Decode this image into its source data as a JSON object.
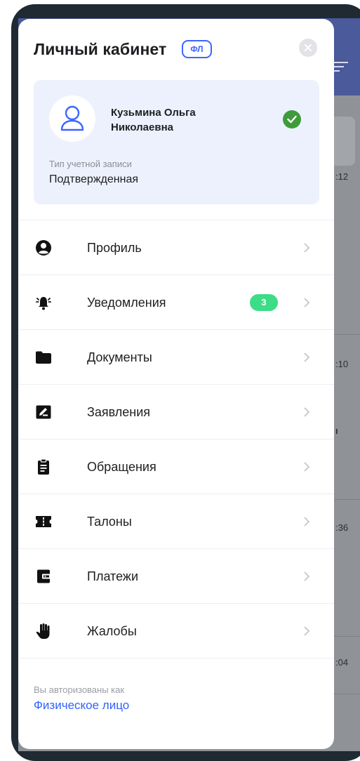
{
  "drawer": {
    "title": "Личный кабинет",
    "badge": "ФЛ",
    "close_icon": "close-icon"
  },
  "user": {
    "name": "Кузьмина Ольга Николаевна",
    "account_type_label": "Тип учетной записи",
    "account_type_value": "Подтвержденная",
    "avatar_icon": "user-outline-icon",
    "verified_icon": "check-circle-icon"
  },
  "menu": {
    "items": [
      {
        "label": "Профиль",
        "icon": "account-circle-icon"
      },
      {
        "label": "Уведомления",
        "icon": "bell-ringing-icon",
        "badge": "3"
      },
      {
        "label": "Документы",
        "icon": "folder-icon"
      },
      {
        "label": "Заявления",
        "icon": "edit-note-icon"
      },
      {
        "label": "Обращения",
        "icon": "clipboard-text-icon"
      },
      {
        "label": "Талоны",
        "icon": "ticket-icon"
      },
      {
        "label": "Платежи",
        "icon": "wallet-icon"
      },
      {
        "label": "Жалобы",
        "icon": "hand-icon"
      }
    ]
  },
  "footer": {
    "label": "Вы авторизованы как",
    "link": "Физическое лицо"
  },
  "background": {
    "times": [
      ":12",
      ":10",
      ":36",
      ":04"
    ]
  },
  "colors": {
    "accent": "#3b66ff",
    "badge_green": "#3ddc87",
    "verified_green": "#3f9b3a",
    "card_bg": "#edf1fd"
  }
}
